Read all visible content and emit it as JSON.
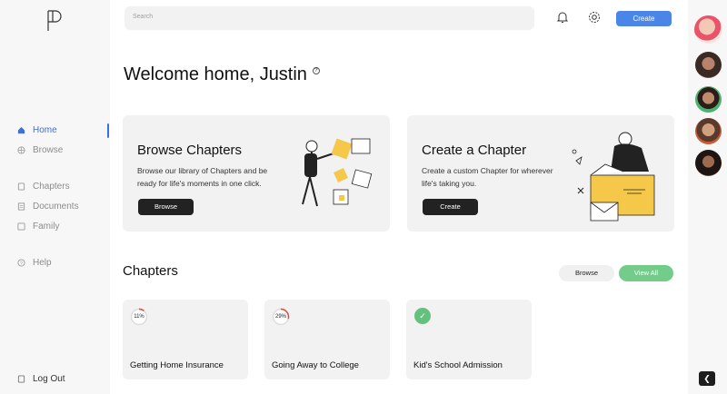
{
  "search": {
    "placeholder": "Search"
  },
  "header": {
    "create_label": "Create"
  },
  "sidebar": {
    "items": [
      {
        "label": "Home",
        "icon": "home-icon",
        "active": true
      },
      {
        "label": "Browse",
        "icon": "globe-icon"
      },
      {
        "label": "Chapters",
        "icon": "book-icon"
      },
      {
        "label": "Documents",
        "icon": "document-icon"
      },
      {
        "label": "Family",
        "icon": "family-icon"
      },
      {
        "label": "Help",
        "icon": "help-icon"
      },
      {
        "label": "Log Out",
        "icon": "logout-icon"
      }
    ],
    "accent": "#3f6fd8"
  },
  "welcome": {
    "title": "Welcome home, Justin"
  },
  "browse_card": {
    "title": "Browse Chapters",
    "description": "Browse our library of Chapters and be ready for life's moments in one click.",
    "button": "Browse"
  },
  "create_card": {
    "title": "Create a Chapter",
    "description": "Create a custom Chapter for wherever life's taking you.",
    "button": "Create"
  },
  "chapters": {
    "title": "Chapters",
    "browse_label": "Browse",
    "view_all_label": "View All",
    "items": [
      {
        "label": "Getting Home Insurance",
        "progress_text": "11%",
        "progress": 0.11
      },
      {
        "label": "Going Away to College",
        "progress_text": "29%",
        "progress": 0.29
      },
      {
        "label": "Kid's School Admission",
        "progress": 1.0,
        "complete": true
      }
    ]
  },
  "colors": {
    "primary": "#4a86e8",
    "success": "#74cc8b",
    "progress_ring": "#e04a3a"
  }
}
